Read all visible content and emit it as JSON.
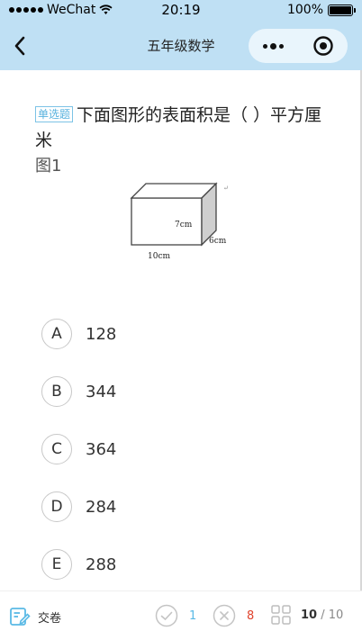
{
  "status_bar": {
    "carrier": "WeChat",
    "time": "20:19",
    "battery": "100%"
  },
  "nav": {
    "title": "五年级数学",
    "back_icon": "chevron-left-icon",
    "more_icon": "more-dots-icon",
    "close_icon": "target-close-icon"
  },
  "question": {
    "type_tag": "单选题",
    "text": "下面图形的表面积是（  ）平方厘米",
    "figure_label": "图1",
    "figure": {
      "label_height": "7cm",
      "label_depth": "6cm",
      "label_length": "10cm"
    }
  },
  "options": [
    {
      "letter": "A",
      "value": "128"
    },
    {
      "letter": "B",
      "value": "344"
    },
    {
      "letter": "C",
      "value": "364"
    },
    {
      "letter": "D",
      "value": "284"
    },
    {
      "letter": "E",
      "value": "288"
    }
  ],
  "bottom_bar": {
    "submit_label": "交卷",
    "correct_count": "1",
    "wrong_count": "8",
    "progress_current": "10",
    "progress_separator": " / ",
    "progress_total": "10"
  },
  "colors": {
    "header_bg": "#bfe0f4",
    "accent": "#58b2de",
    "wrong": "#e0432d"
  }
}
